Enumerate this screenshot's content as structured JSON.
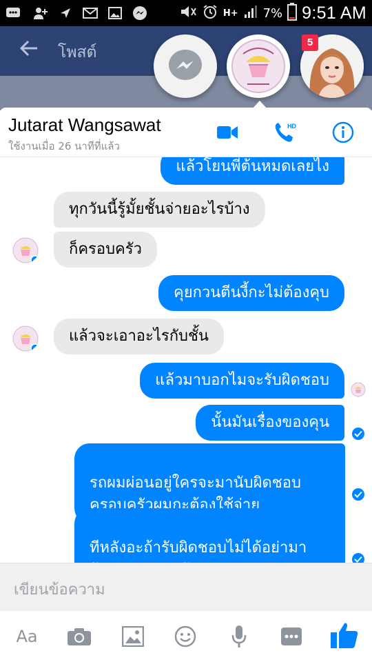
{
  "status_bar": {
    "battery": "7%",
    "time": "9:51 AM",
    "network": "H+"
  },
  "background_app": {
    "title": "โพสต์"
  },
  "chat_heads": {
    "unread_badge": "5"
  },
  "chat": {
    "name": "Jutarat Wangsawat",
    "status": "ใช้งานเมื่อ 26 นาทีที่แล้ว"
  },
  "messages": [
    {
      "dir": "out",
      "text": "แล้วโยนพี่ต้นหมดเลยไง"
    },
    {
      "dir": "in",
      "text": "ทุกวันนี้รู้มั้ยชั้นจ่ายอะไรบ้าง"
    },
    {
      "dir": "in",
      "text": "ก็ครอบครัว"
    },
    {
      "dir": "out",
      "text": "คุยกวนตีนงี้กะไม่ต้องคุบ"
    },
    {
      "dir": "in",
      "text": "แล้วจะเอาอะไรกับชั้น"
    },
    {
      "dir": "out",
      "text": "แล้วมาบอกไมจะรับผิดชอบ"
    },
    {
      "dir": "out",
      "text": "นั้นมันเรื่องของคุน"
    },
    {
      "dir": "out",
      "text": "รถผมผ่อนอยู่ใครจะมานับผิดชอบ\nครอบครัวผมกะต้องใช้จ่าย"
    },
    {
      "dir": "out",
      "text": "ทีหลังอะถ้ารับผิดชอบไม่ได้อย่ามา\nรับปากอย่ามานัด"
    }
  ],
  "composer": {
    "placeholder": "เขียนข้อความ",
    "text_tool_label": "Aa"
  },
  "colors": {
    "messenger_blue": "#0084ff",
    "incoming_bubble": "#e9e9eb",
    "header_icon": "#0084ff",
    "badge_red": "#f02849"
  },
  "icons": [
    "phone-icon",
    "video-camera-icon",
    "hd-call-icon",
    "info-icon",
    "camera-icon",
    "gallery-icon",
    "emoji-icon",
    "microphone-icon",
    "more-icon",
    "like-icon"
  ]
}
